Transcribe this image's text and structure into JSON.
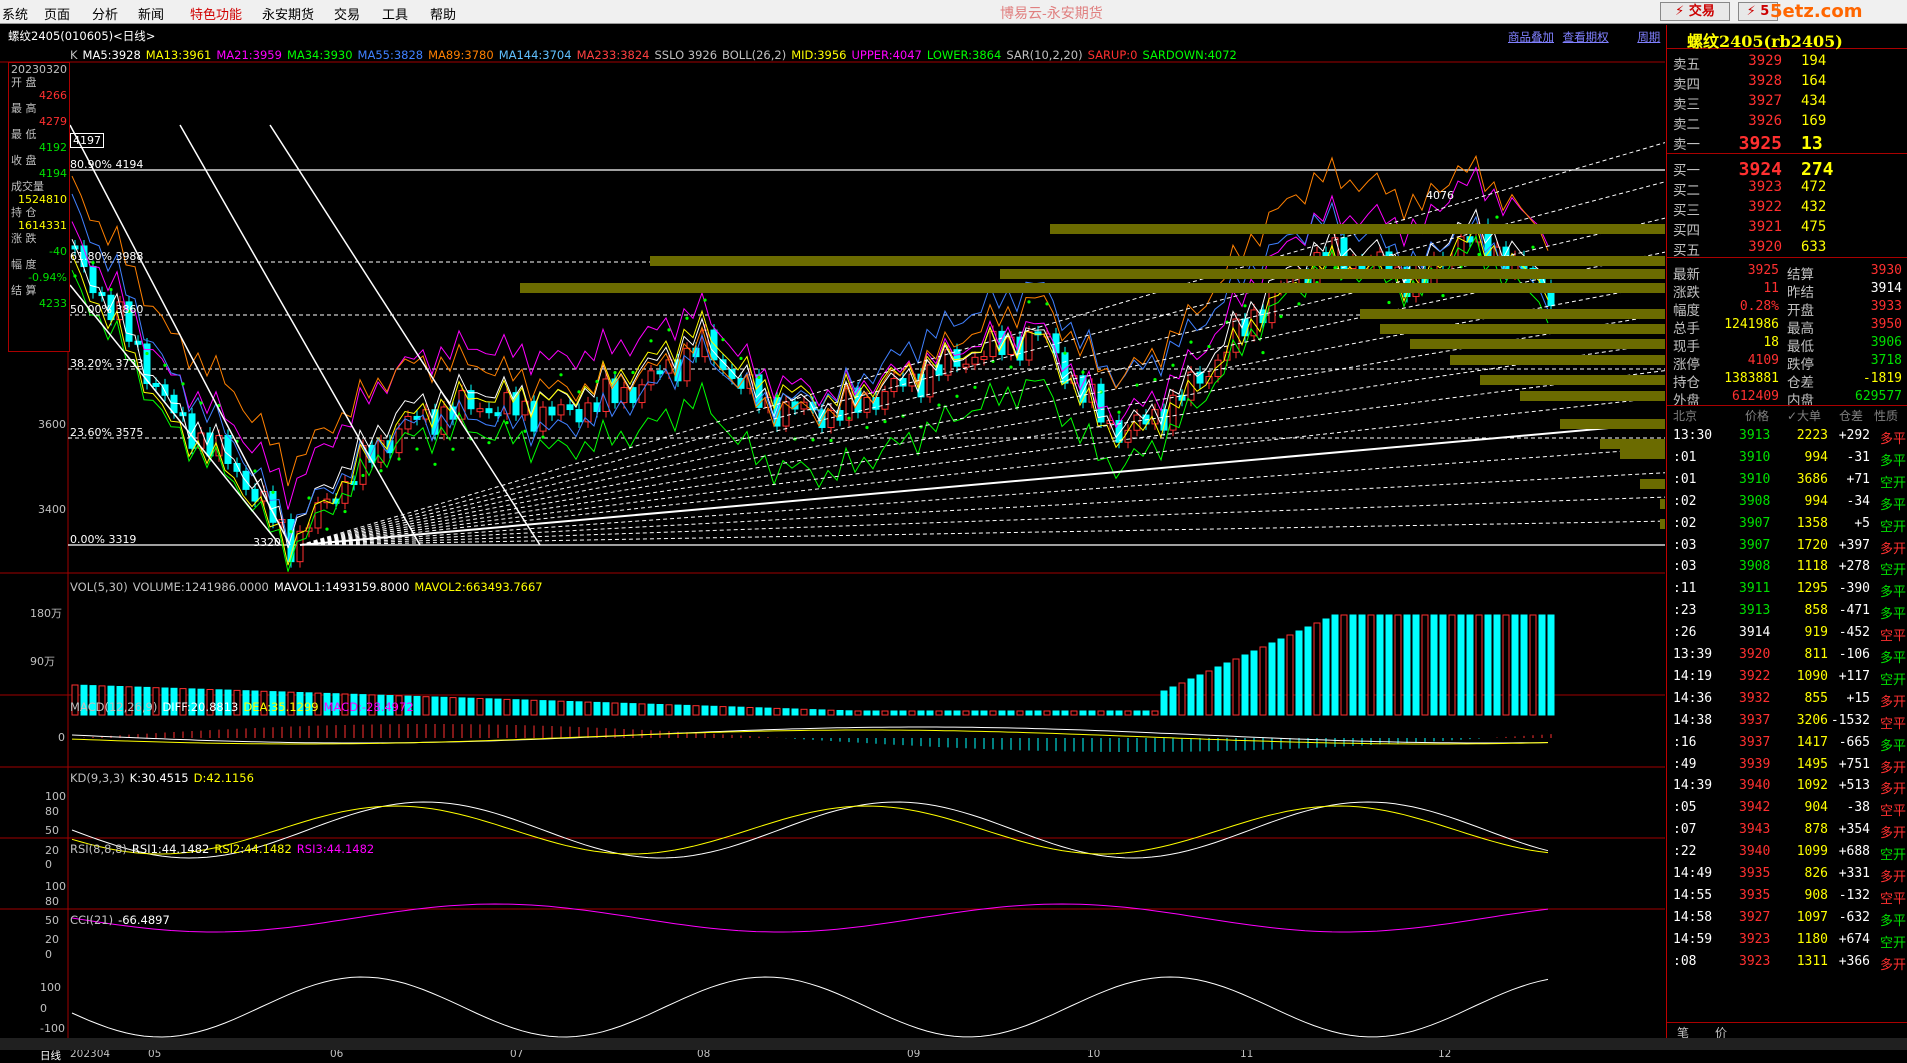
{
  "menu": [
    "系统",
    "页面",
    "分析",
    "新闻",
    "特色功能",
    "永安期货",
    "交易",
    "工具",
    "帮助"
  ],
  "app_title": "博易云-永安期货",
  "top_buttons": {
    "trade": "⚡ 交易",
    "other": "⚡ 5"
  },
  "watermark": "5etz.com",
  "chart": {
    "symbol_title": "螺纹2405(010605)<日线>",
    "ma_legend": [
      {
        "text": "K",
        "color": "#c0c0c0"
      },
      {
        "text": "MA5:3928",
        "color": "#ffffff"
      },
      {
        "text": "MA13:3961",
        "color": "#ffff00"
      },
      {
        "text": "MA21:3959",
        "color": "#ff00ff"
      },
      {
        "text": "MA34:3930",
        "color": "#00ff00"
      },
      {
        "text": "MA55:3828",
        "color": "#4080ff"
      },
      {
        "text": "MA89:3780",
        "color": "#ff8000"
      },
      {
        "text": "MA144:3704",
        "color": "#60c0ff"
      },
      {
        "text": "MA233:3824",
        "color": "#ff4040"
      },
      {
        "text": "SSLO 3926",
        "color": "#c0c0c0"
      },
      {
        "text": "BOLL(26,2)",
        "color": "#c0c0c0"
      },
      {
        "text": "MID:3956",
        "color": "#ffff00"
      },
      {
        "text": "UPPER:4047",
        "color": "#ff00ff"
      },
      {
        "text": "LOWER:3864",
        "color": "#00ff00"
      },
      {
        "text": "SAR(10,2,20)",
        "color": "#c0c0c0"
      },
      {
        "text": "SARUP:0",
        "color": "#ff3030"
      },
      {
        "text": "SARDOWN:4072",
        "color": "#00ff00"
      }
    ],
    "links": [
      "商品叠加",
      "查看期权",
      "周期"
    ],
    "price_axis": [
      "3600",
      "3400"
    ],
    "fib_labels": [
      "80.90% 4194",
      "61.80% 3988",
      "50.00% 3860",
      "38.20% 3733",
      "23.60% 3575",
      "0.00% 3319"
    ],
    "high_marker": "4197",
    "peak_label": "4076",
    "low_label": "3320",
    "info_box": [
      {
        "label": "20230320",
        "value": "",
        "color": "#ffffff"
      },
      {
        "label": "开 盘",
        "value": "4266",
        "color": "#ff3030"
      },
      {
        "label": "最 高",
        "value": "4279",
        "color": "#ff3030"
      },
      {
        "label": "最 低",
        "value": "4192",
        "color": "#00e000"
      },
      {
        "label": "收 盘",
        "value": "4194",
        "color": "#00e000"
      },
      {
        "label": "成交量",
        "value": "1524810",
        "color": "#ffff00"
      },
      {
        "label": "持 仓",
        "value": "1614331",
        "color": "#ffff00"
      },
      {
        "label": "涨 跌",
        "value": "-40",
        "color": "#00e000"
      },
      {
        "label": "幅 度",
        "value": "-0.94%",
        "color": "#00e000"
      },
      {
        "label": "结 算",
        "value": "4233",
        "color": "#00e000"
      }
    ],
    "vol_legend": [
      {
        "text": "VOL(5,30)",
        "color": "#c0c0c0"
      },
      {
        "text": "VOLUME:1241986.0000",
        "color": "#c0c0c0"
      },
      {
        "text": "MAVOL1:1493159.8000",
        "color": "#ffffff"
      },
      {
        "text": "MAVOL2:663493.7667",
        "color": "#ffff00"
      }
    ],
    "vol_axis": [
      "180万",
      "90万"
    ],
    "macd_legend": [
      {
        "text": "MACD(12,26,9)",
        "color": "#c0c0c0"
      },
      {
        "text": "DIFF:20.8813",
        "color": "#ffffff"
      },
      {
        "text": "DEA:35.1299",
        "color": "#ffff00"
      },
      {
        "text": "MACD:-28.4972",
        "color": "#ff00ff"
      }
    ],
    "macd_axis": [
      "0"
    ],
    "kd_legend": [
      {
        "text": "KD(9,3,3)",
        "color": "#c0c0c0"
      },
      {
        "text": "K:30.4515",
        "color": "#ffffff"
      },
      {
        "text": "D:42.1156",
        "color": "#ffff00"
      }
    ],
    "kd_axis": [
      "100",
      "80",
      "50",
      "20",
      "0"
    ],
    "rsi_legend": [
      {
        "text": "RSI(8,8,8)",
        "color": "#c0c0c0"
      },
      {
        "text": "RSI1:44.1482",
        "color": "#ffffff"
      },
      {
        "text": "RSI2:44.1482",
        "color": "#ffff00"
      },
      {
        "text": "RSI3:44.1482",
        "color": "#ff00ff"
      }
    ],
    "rsi_axis": [
      "100",
      "80",
      "50",
      "20",
      "0"
    ],
    "cci_legend": [
      {
        "text": "CCI(21)",
        "color": "#c0c0c0"
      },
      {
        "text": "-66.4897",
        "color": "#ffffff"
      }
    ],
    "cci_axis": [
      "100",
      "0",
      "-100"
    ],
    "date_axis": [
      "日线",
      "202304",
      "05",
      "06",
      "07",
      "08",
      "09",
      "10",
      "11",
      "12"
    ]
  },
  "panel": {
    "title": "螺纹2405(rb2405)",
    "asks": [
      {
        "label": "卖五",
        "price": "3929",
        "vol": "194"
      },
      {
        "label": "卖四",
        "price": "3928",
        "vol": "164"
      },
      {
        "label": "卖三",
        "price": "3927",
        "vol": "434"
      },
      {
        "label": "卖二",
        "price": "3926",
        "vol": "169"
      },
      {
        "label": "卖一",
        "price": "3925",
        "vol": "13"
      }
    ],
    "bids": [
      {
        "label": "买一",
        "price": "3924",
        "vol": "274"
      },
      {
        "label": "买二",
        "price": "3923",
        "vol": "472"
      },
      {
        "label": "买三",
        "price": "3922",
        "vol": "432"
      },
      {
        "label": "买四",
        "price": "3921",
        "vol": "475"
      },
      {
        "label": "买五",
        "price": "3920",
        "vol": "633"
      }
    ],
    "stats": [
      {
        "l1": "最新",
        "v1": "3925",
        "c1": "#ff3030",
        "l2": "结算",
        "v2": "3930",
        "c2": "#ff3030"
      },
      {
        "l1": "涨跌",
        "v1": "11",
        "c1": "#ff3030",
        "l2": "昨结",
        "v2": "3914",
        "c2": "#ffffff"
      },
      {
        "l1": "幅度",
        "v1": "0.28%",
        "c1": "#ff3030",
        "l2": "开盘",
        "v2": "3933",
        "c2": "#ff3030"
      },
      {
        "l1": "总手",
        "v1": "1241986",
        "c1": "#ffff00",
        "l2": "最高",
        "v2": "3950",
        "c2": "#ff3030"
      },
      {
        "l1": "现手",
        "v1": "18",
        "c1": "#ffff00",
        "l2": "最低",
        "v2": "3906",
        "c2": "#00e000"
      },
      {
        "l1": "涨停",
        "v1": "4109",
        "c1": "#ff3030",
        "l2": "跌停",
        "v2": "3718",
        "c2": "#00e000"
      },
      {
        "l1": "持仓",
        "v1": "1383881",
        "c1": "#ffff00",
        "l2": "仓差",
        "v2": "-1819",
        "c2": "#ffff00"
      },
      {
        "l1": "外盘",
        "v1": "612409",
        "c1": "#ff3030",
        "l2": "内盘",
        "v2": "629577",
        "c2": "#00e000"
      }
    ],
    "tick_header": [
      "北京",
      "价格",
      "✓大单",
      "仓差",
      "性质"
    ],
    "ticks": [
      {
        "t": "13:30",
        "p": "3913",
        "pc": "#00e000",
        "v": "2223",
        "c": "+292",
        "n": "多平",
        "nc": "#ff3030"
      },
      {
        "t": ":01",
        "p": "3910",
        "pc": "#00e000",
        "v": "994",
        "c": "-31",
        "n": "多平",
        "nc": "#00e000"
      },
      {
        "t": ":01",
        "p": "3910",
        "pc": "#00e000",
        "v": "3686",
        "c": "+71",
        "n": "空开",
        "nc": "#00e000"
      },
      {
        "t": ":02",
        "p": "3908",
        "pc": "#00e000",
        "v": "994",
        "c": "-34",
        "n": "多平",
        "nc": "#00e000"
      },
      {
        "t": ":02",
        "p": "3907",
        "pc": "#00e000",
        "v": "1358",
        "c": "+5",
        "n": "空开",
        "nc": "#00e000"
      },
      {
        "t": ":03",
        "p": "3907",
        "pc": "#00e000",
        "v": "1720",
        "c": "+397",
        "n": "多开",
        "nc": "#ff3030"
      },
      {
        "t": ":03",
        "p": "3908",
        "pc": "#00e000",
        "v": "1118",
        "c": "+278",
        "n": "空开",
        "nc": "#00e000"
      },
      {
        "t": ":11",
        "p": "3911",
        "pc": "#00e000",
        "v": "1295",
        "c": "-390",
        "n": "多平",
        "nc": "#00e000"
      },
      {
        "t": ":23",
        "p": "3913",
        "pc": "#00e000",
        "v": "858",
        "c": "-471",
        "n": "多平",
        "nc": "#00e000"
      },
      {
        "t": ":26",
        "p": "3914",
        "pc": "#ffffff",
        "v": "919",
        "c": "-452",
        "n": "空平",
        "nc": "#ff3030"
      },
      {
        "t": "13:39",
        "p": "3920",
        "pc": "#ff3030",
        "v": "811",
        "c": "-106",
        "n": "多平",
        "nc": "#00e000"
      },
      {
        "t": "14:19",
        "p": "3922",
        "pc": "#ff3030",
        "v": "1090",
        "c": "+117",
        "n": "空开",
        "nc": "#00e000"
      },
      {
        "t": "14:36",
        "p": "3932",
        "pc": "#ff3030",
        "v": "855",
        "c": "+15",
        "n": "多开",
        "nc": "#ff3030"
      },
      {
        "t": "14:38",
        "p": "3937",
        "pc": "#ff3030",
        "v": "3206",
        "c": "-1532",
        "n": "空平",
        "nc": "#ff3030"
      },
      {
        "t": ":16",
        "p": "3937",
        "pc": "#ff3030",
        "v": "1417",
        "c": "-665",
        "n": "多平",
        "nc": "#00e000"
      },
      {
        "t": ":49",
        "p": "3939",
        "pc": "#ff3030",
        "v": "1495",
        "c": "+751",
        "n": "多开",
        "nc": "#ff3030"
      },
      {
        "t": "14:39",
        "p": "3940",
        "pc": "#ff3030",
        "v": "1092",
        "c": "+513",
        "n": "多开",
        "nc": "#ff3030"
      },
      {
        "t": ":05",
        "p": "3942",
        "pc": "#ff3030",
        "v": "904",
        "c": "-38",
        "n": "空平",
        "nc": "#ff3030"
      },
      {
        "t": ":07",
        "p": "3943",
        "pc": "#ff3030",
        "v": "878",
        "c": "+354",
        "n": "多开",
        "nc": "#ff3030"
      },
      {
        "t": ":22",
        "p": "3940",
        "pc": "#ff3030",
        "v": "1099",
        "c": "+688",
        "n": "空开",
        "nc": "#00e000"
      },
      {
        "t": "14:49",
        "p": "3935",
        "pc": "#ff3030",
        "v": "826",
        "c": "+331",
        "n": "多开",
        "nc": "#ff3030"
      },
      {
        "t": "14:55",
        "p": "3935",
        "pc": "#ff3030",
        "v": "908",
        "c": "-132",
        "n": "空平",
        "nc": "#ff3030"
      },
      {
        "t": "14:58",
        "p": "3927",
        "pc": "#ff3030",
        "v": "1097",
        "c": "-632",
        "n": "多平",
        "nc": "#00e000"
      },
      {
        "t": "14:59",
        "p": "3923",
        "pc": "#ff3030",
        "v": "1180",
        "c": "+674",
        "n": "空开",
        "nc": "#00e000"
      },
      {
        "t": ":08",
        "p": "3923",
        "pc": "#ff3030",
        "v": "1311",
        "c": "+366",
        "n": "多开",
        "nc": "#ff3030"
      }
    ],
    "bottom_tabs": [
      "笔",
      "价"
    ]
  }
}
